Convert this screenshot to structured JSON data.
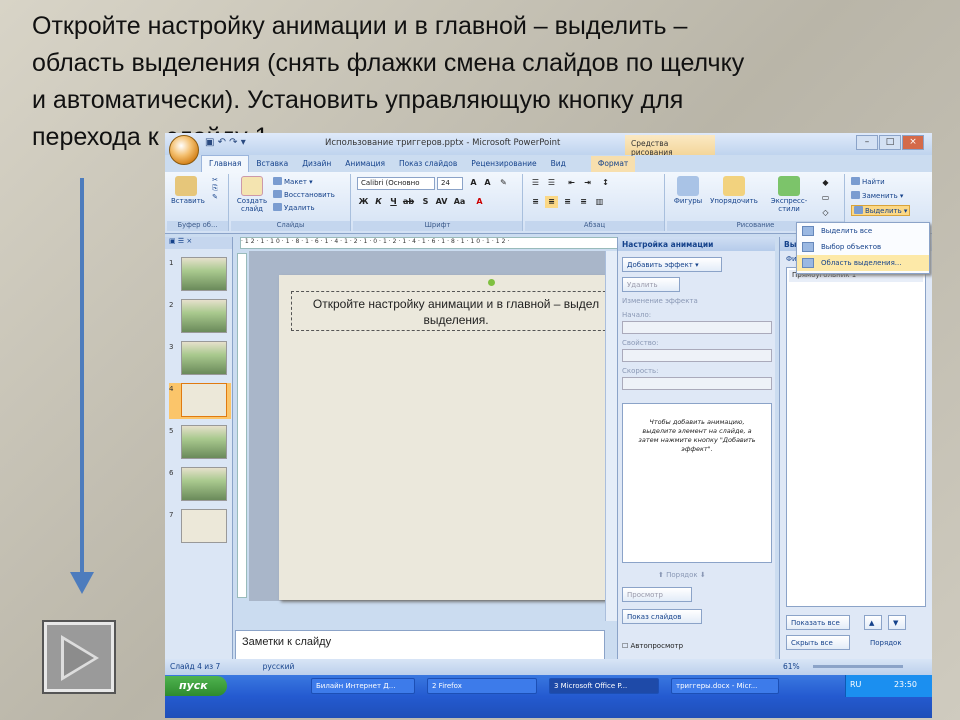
{
  "slide": {
    "heading_lines": [
      "Откройте настройку анимации и в главной – выделить –",
      "область выделения (снять флажки смена слайдов по щелчку",
      "и автоматически). Установить управляющую кнопку для",
      "перехода к слайду 1."
    ]
  },
  "app": {
    "window_title": "Использование триггеров.pptx - Microsoft PowerPoint",
    "context_tool": "Средства рисования",
    "quick_access": "▣ ↶ ↷ ▾",
    "tabs": [
      "Главная",
      "Вставка",
      "Дизайн",
      "Анимация",
      "Показ слайдов",
      "Рецензирование",
      "Вид"
    ],
    "context_tab": "Формат"
  },
  "ribbon": {
    "clipboard": {
      "label": "Буфер об...",
      "paste": "Вставить"
    },
    "slides": {
      "label": "Слайды",
      "create": "Создать слайд",
      "layout": "Макет ▾",
      "reset": "Восстановить",
      "delete": "Удалить"
    },
    "font": {
      "label": "Шрифт",
      "family": "Calibri (Основно",
      "size": "24"
    },
    "paragraph": {
      "label": "Абзац"
    },
    "drawing": {
      "label": "Рисование",
      "shapes": "Фигуры",
      "arrange": "Упорядочить",
      "styles": "Экспресс-стили"
    },
    "editing": {
      "find": "Найти",
      "replace": "Заменить ▾",
      "select": "Выделить ▾"
    }
  },
  "select_menu": {
    "items": [
      "Выделить все",
      "Выбор объектов",
      "Область выделения..."
    ]
  },
  "thumbnails": [
    "1",
    "2",
    "3",
    "4",
    "5",
    "6",
    "7"
  ],
  "ruler_text": "·12·1·10·1·8·1·6·1·4·1·2·1·0·1·2·1·4·1·6·1·8·1·10·1·12·",
  "slide_textbox": {
    "line1": "Откройте настройку анимации и в главной – выдел",
    "line2": "выделения."
  },
  "notes_placeholder": "Заметки к слайду",
  "animation_pane": {
    "title": "Настройка анимации",
    "add_effect": "Добавить эффект ▾",
    "remove": "Удалить",
    "change_effect": "Изменение эффекта",
    "start_label": "Начало:",
    "property_label": "Свойство:",
    "speed_label": "Скорость:",
    "hint": "Чтобы добавить анимацию, выделите элемент на слайде, а затем нажмите кнопку \"Добавить эффект\".",
    "order": "Порядок",
    "preview": "Просмотр",
    "slideshow": "Показ слайдов",
    "autopreview": "Автопросмотр"
  },
  "selection_pane": {
    "title": "Вы",
    "shapes_label": "Фи",
    "item": "Прямоугольник 1",
    "show_all": "Показать все",
    "hide_all": "Скрыть все",
    "order": "Порядок"
  },
  "statusbar": {
    "slide_info": "Слайд 4 из 7",
    "language": "русский",
    "zoom": "61%"
  },
  "taskbar": {
    "start": "пуск",
    "buttons": [
      "Билайн Интернет Д...",
      "2 Firefox",
      "3 Microsoft Office P...",
      "триггеры.docx - Micr..."
    ],
    "lang": "RU",
    "time": "23:50"
  },
  "colors": {
    "accent": "#4d7cbd",
    "ribbon": "#d3e1f4",
    "taskbar": "#245ad0"
  }
}
